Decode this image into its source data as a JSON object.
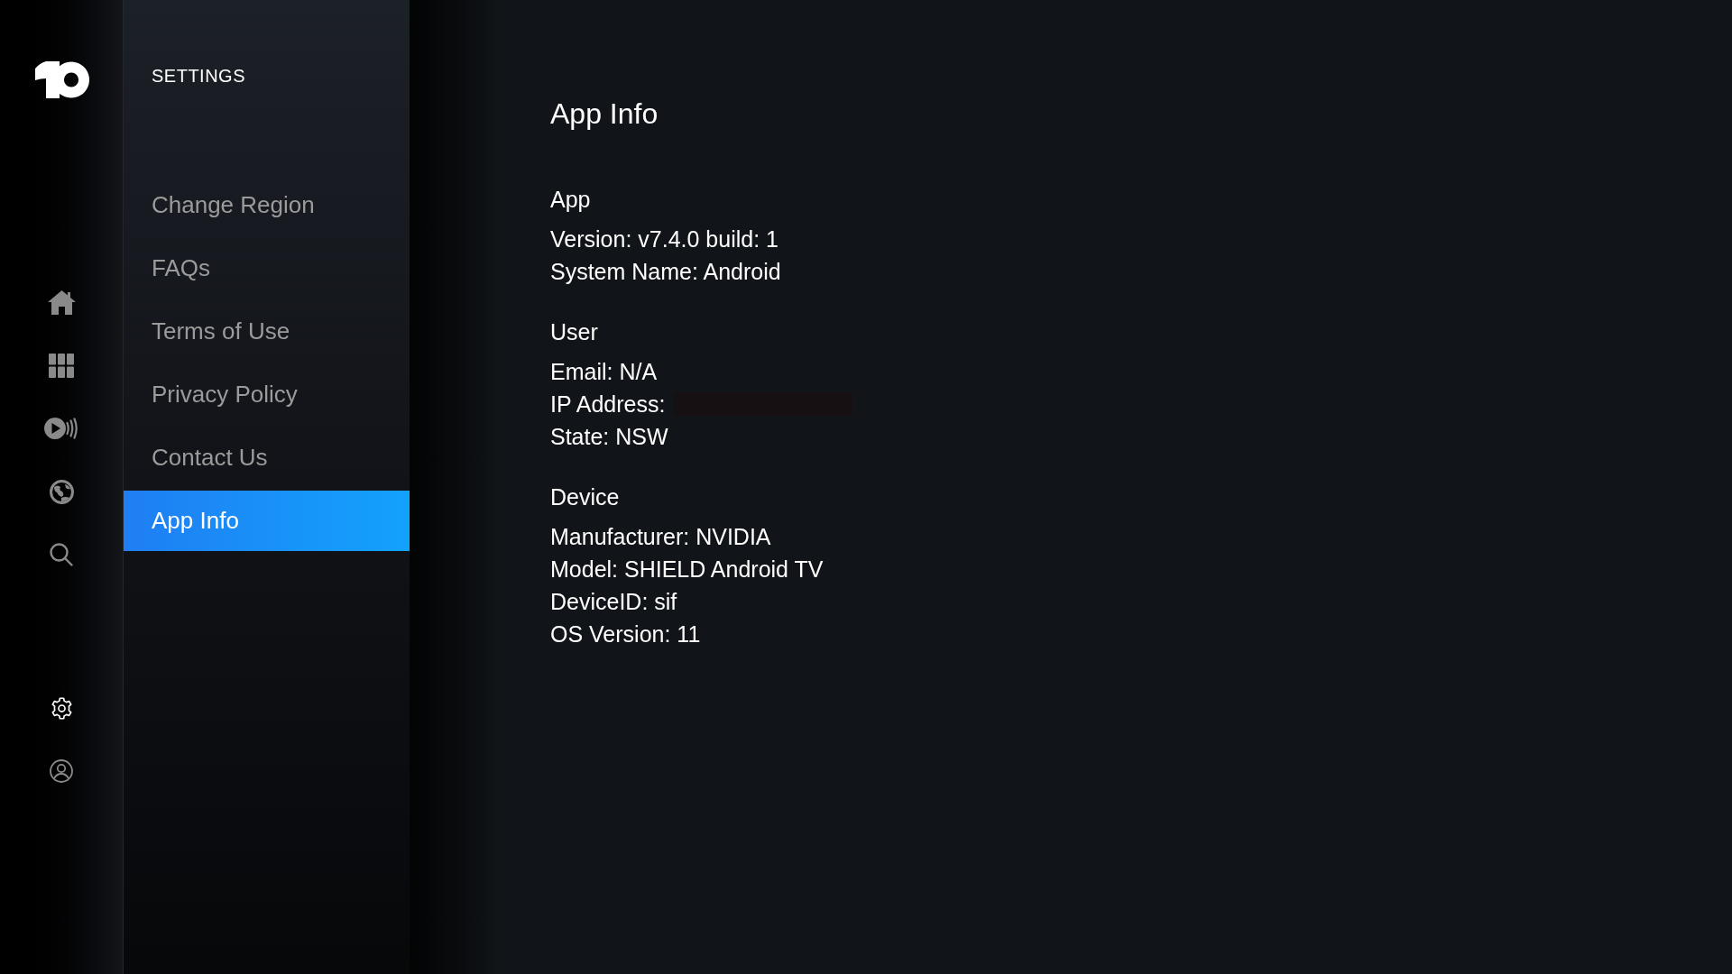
{
  "nav_rail": {
    "items": [
      {
        "kind": "home",
        "selected": false
      },
      {
        "kind": "grid",
        "selected": false
      },
      {
        "kind": "live",
        "selected": false
      },
      {
        "kind": "globe",
        "selected": false
      },
      {
        "kind": "search",
        "selected": false
      }
    ],
    "bottom_items": [
      {
        "kind": "settings",
        "selected": true
      },
      {
        "kind": "profile",
        "selected": false
      }
    ]
  },
  "settings_menu": {
    "title": "SETTINGS",
    "items": [
      {
        "label": "Change Region",
        "selected": false
      },
      {
        "label": "FAQs",
        "selected": false
      },
      {
        "label": "Terms of Use",
        "selected": false
      },
      {
        "label": "Privacy Policy",
        "selected": false
      },
      {
        "label": "Contact Us",
        "selected": false
      },
      {
        "label": "App Info",
        "selected": true
      }
    ]
  },
  "content": {
    "title": "App Info",
    "sections": [
      {
        "heading": "App",
        "lines": [
          {
            "text": "Version: v7.4.0 build: 1",
            "redacted": false
          },
          {
            "text": "System Name: Android",
            "redacted": false
          }
        ]
      },
      {
        "heading": "User",
        "lines": [
          {
            "text": "Email: N/A",
            "redacted": false
          },
          {
            "text": "IP Address:",
            "redacted": true
          },
          {
            "text": "State: NSW",
            "redacted": false
          }
        ]
      },
      {
        "heading": "Device",
        "lines": [
          {
            "text": "Manufacturer: NVIDIA",
            "redacted": false
          },
          {
            "text": "Model: SHIELD Android TV",
            "redacted": false
          },
          {
            "text": "DeviceID: sif",
            "redacted": false
          },
          {
            "text": "OS Version: 11",
            "redacted": false
          }
        ]
      }
    ]
  }
}
